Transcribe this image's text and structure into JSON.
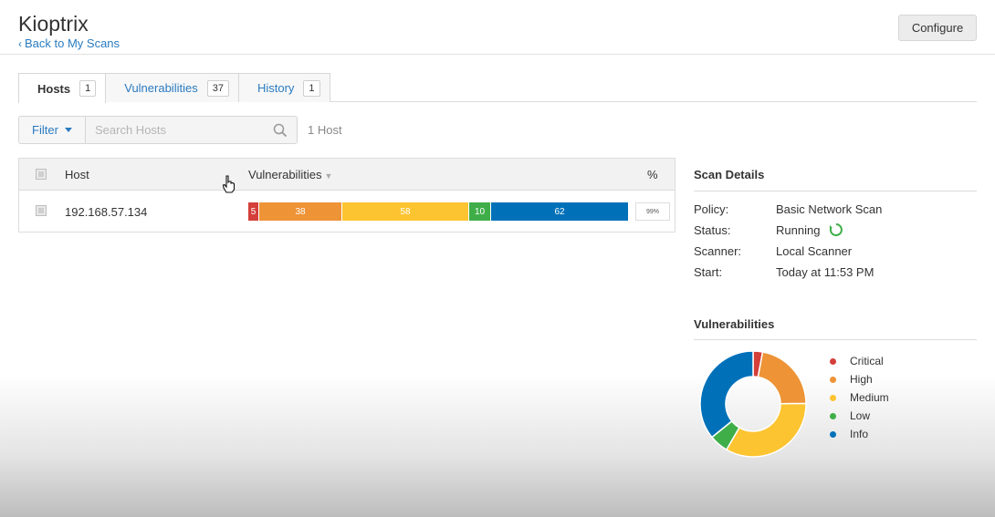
{
  "header": {
    "title": "Kioptrix",
    "back_link": "Back to My Scans",
    "configure_label": "Configure"
  },
  "tabs": [
    {
      "label": "Hosts",
      "count": "1",
      "active": true
    },
    {
      "label": "Vulnerabilities",
      "count": "37",
      "active": false
    },
    {
      "label": "History",
      "count": "1",
      "active": false
    }
  ],
  "filter": {
    "button_label": "Filter",
    "search_placeholder": "Search Hosts",
    "host_count": "1 Host"
  },
  "table": {
    "columns": {
      "host": "Host",
      "vulnerabilities": "Vulnerabilities",
      "percent": "%"
    },
    "rows": [
      {
        "host": "192.168.57.134",
        "segments": [
          {
            "label": "5",
            "value": 5,
            "color": "#d43f3a"
          },
          {
            "label": "38",
            "value": 38,
            "color": "#ee9336"
          },
          {
            "label": "58",
            "value": 58,
            "color": "#fdc431"
          },
          {
            "label": "10",
            "value": 10,
            "color": "#3fae49"
          },
          {
            "label": "62",
            "value": 62,
            "color": "#0071b9"
          }
        ],
        "percent": "99%"
      }
    ]
  },
  "scan_details": {
    "title": "Scan Details",
    "policy_label": "Policy:",
    "policy_value": "Basic Network Scan",
    "status_label": "Status:",
    "status_value": "Running",
    "scanner_label": "Scanner:",
    "scanner_value": "Local Scanner",
    "start_label": "Start:",
    "start_value": "Today at 11:53 PM"
  },
  "vuln_panel": {
    "title": "Vulnerabilities",
    "legend": [
      {
        "label": "Critical",
        "value": 5,
        "color": "#d43f3a"
      },
      {
        "label": "High",
        "value": 38,
        "color": "#ee9336"
      },
      {
        "label": "Medium",
        "value": 58,
        "color": "#fdc431"
      },
      {
        "label": "Low",
        "value": 10,
        "color": "#3fae49"
      },
      {
        "label": "Info",
        "value": 62,
        "color": "#0071b9"
      }
    ]
  },
  "icons": {
    "back": "chevron-left-icon",
    "search": "search-icon",
    "status": "refresh-icon",
    "cursor": "hand-cursor-icon"
  }
}
